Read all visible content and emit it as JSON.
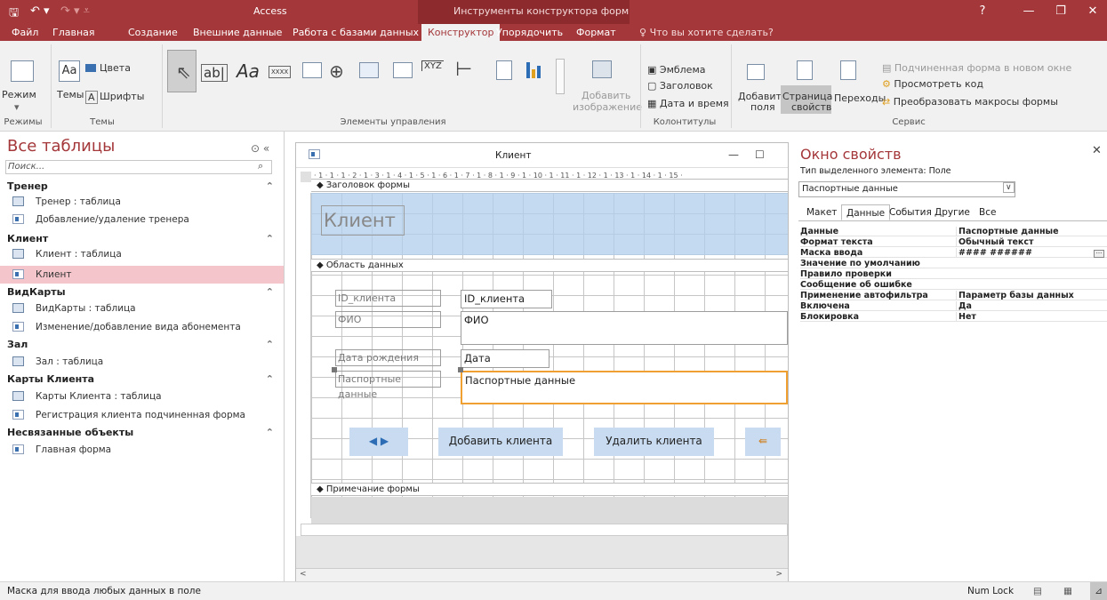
{
  "window": {
    "app_title": "Access",
    "context_title": "Инструменты конструктора форм",
    "help": "?"
  },
  "tabs": [
    "Файл",
    "Главная",
    "Создание",
    "Внешние данные",
    "Работа с базами данных",
    "Конструктор",
    "Упорядочить",
    "Формат"
  ],
  "tellme": "Что вы хотите сделать?",
  "ribbon": {
    "mode": "Режим",
    "themes": "Темы",
    "colors": "Цвета",
    "fonts": "Шрифты",
    "textbox_icon": "ab|",
    "label_icon": "Aa",
    "xxxx": "XXXX",
    "xyz": "XYZ",
    "add_image_1": "Добавить",
    "add_image_2": "изображение",
    "logo": "Эмблема",
    "title": "Заголовок",
    "datetime": "Дата и время",
    "add_fields_1": "Добавить",
    "add_fields_2": "поля",
    "property_sheet_1": "Страница",
    "property_sheet_2": "свойств",
    "tab_order": "Переходы",
    "subform": "Подчиненная форма в новом окне",
    "view_code": "Просмотреть код",
    "convert_macros": "Преобразовать макросы формы",
    "groups": {
      "modes": "Режимы",
      "themes": "Темы",
      "controls": "Элементы управления",
      "header_footer": "Колонтитулы",
      "tools": "Сервис"
    }
  },
  "nav": {
    "title": "Все таблицы",
    "search_placeholder": "Поиск...",
    "groups": [
      {
        "name": "Тренер",
        "items": [
          "Тренер : таблица",
          "Добавление/удаление тренера"
        ]
      },
      {
        "name": "Клиент",
        "items": [
          "Клиент : таблица",
          "Клиент"
        ]
      },
      {
        "name": "ВидКарты",
        "items": [
          "ВидКарты : таблица",
          "Изменение/добавление вида абонемента"
        ]
      },
      {
        "name": "Зал",
        "items": [
          "Зал : таблица"
        ]
      },
      {
        "name": "Карты Клиента",
        "items": [
          "Карты Клиента : таблица",
          "Регистрация клиента подчиненная форма"
        ]
      },
      {
        "name": "Несвязанные объекты",
        "items": [
          "Главная форма"
        ]
      }
    ]
  },
  "form": {
    "window_title": "Клиент",
    "header_section": "Заголовок формы",
    "detail_section": "Область данных",
    "footer_section": "Примечание формы",
    "ruler": "· 1 · 1 · 1 · 2 · 1 · 3 · 1 · 4 · 1 · 5 · 1 · 6 · 1 · 7 · 1 · 8 · 1 · 9 · 1 · 10 · 1 · 11 · 1 · 12 · 1 · 13 · 1 · 14 · 1 · 15 ·",
    "form_title": "Клиент",
    "fields": [
      {
        "label": "ID_клиента",
        "box": "ID_клиента"
      },
      {
        "label": "ФИО",
        "box": "ФИО"
      },
      {
        "label": "Дата рождения",
        "box": "Дата рождения"
      },
      {
        "label": "Паспортные данные",
        "box": "Паспортные данные"
      }
    ],
    "add_button": "Добавить клиента",
    "delete_button": "Удалить клиента"
  },
  "props": {
    "title": "Окно свойств",
    "type_label": "Тип выделенного элемента:  Поле",
    "selected": "Паспортные данные",
    "tabs": [
      "Макет",
      "Данные",
      "События",
      "Другие",
      "Все"
    ],
    "active_tab": "Данные",
    "rows": [
      [
        "Данные",
        "Паспортные данные"
      ],
      [
        "Формат текста",
        "Обычный текст"
      ],
      [
        "Маска ввода",
        "#### ###### "
      ],
      [
        "Значение по умолчанию",
        ""
      ],
      [
        "Правило проверки",
        ""
      ],
      [
        "Сообщение об ошибке",
        ""
      ],
      [
        "Применение автофильтра",
        "Параметр базы данных"
      ],
      [
        "Включена",
        "Да"
      ],
      [
        "Блокировка",
        "Нет"
      ]
    ]
  },
  "status": {
    "text": "Маска для ввода любых данных в поле",
    "numlock": "Num Lock"
  },
  "colors": {
    "accent": "#a4373a",
    "selection": "#f4c6cb",
    "button": "#c8dbf0",
    "highlight": "#f0a030"
  }
}
